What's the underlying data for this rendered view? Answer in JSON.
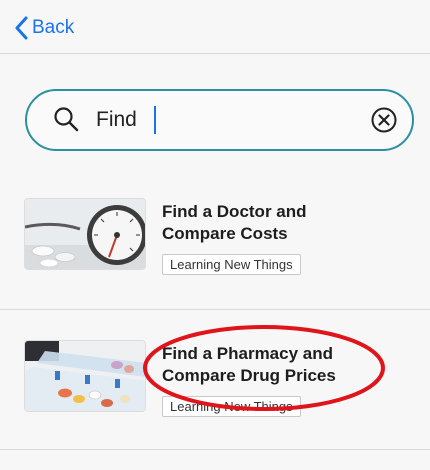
{
  "nav": {
    "back_label": "Back",
    "back_icon": "chevron-left-icon"
  },
  "search": {
    "value": "Find",
    "search_icon": "magnifier-icon",
    "clear_icon": "clear-circle-icon"
  },
  "results": [
    {
      "title_line1": "Find a Doctor and",
      "title_line2": "Compare Costs",
      "tag": "Learning New Things",
      "thumbnail": "blood-pressure-gauge-and-pills-image"
    },
    {
      "title_line1": "Find a Pharmacy and",
      "title_line2": "Compare Drug Prices",
      "tag": "Learning New Things",
      "thumbnail": "pill-organizer-image"
    }
  ],
  "annotation": {
    "color": "#e0141b",
    "shape": "ellipse"
  },
  "colors": {
    "link": "#1a73e8",
    "search_border": "#2b8fa0"
  }
}
